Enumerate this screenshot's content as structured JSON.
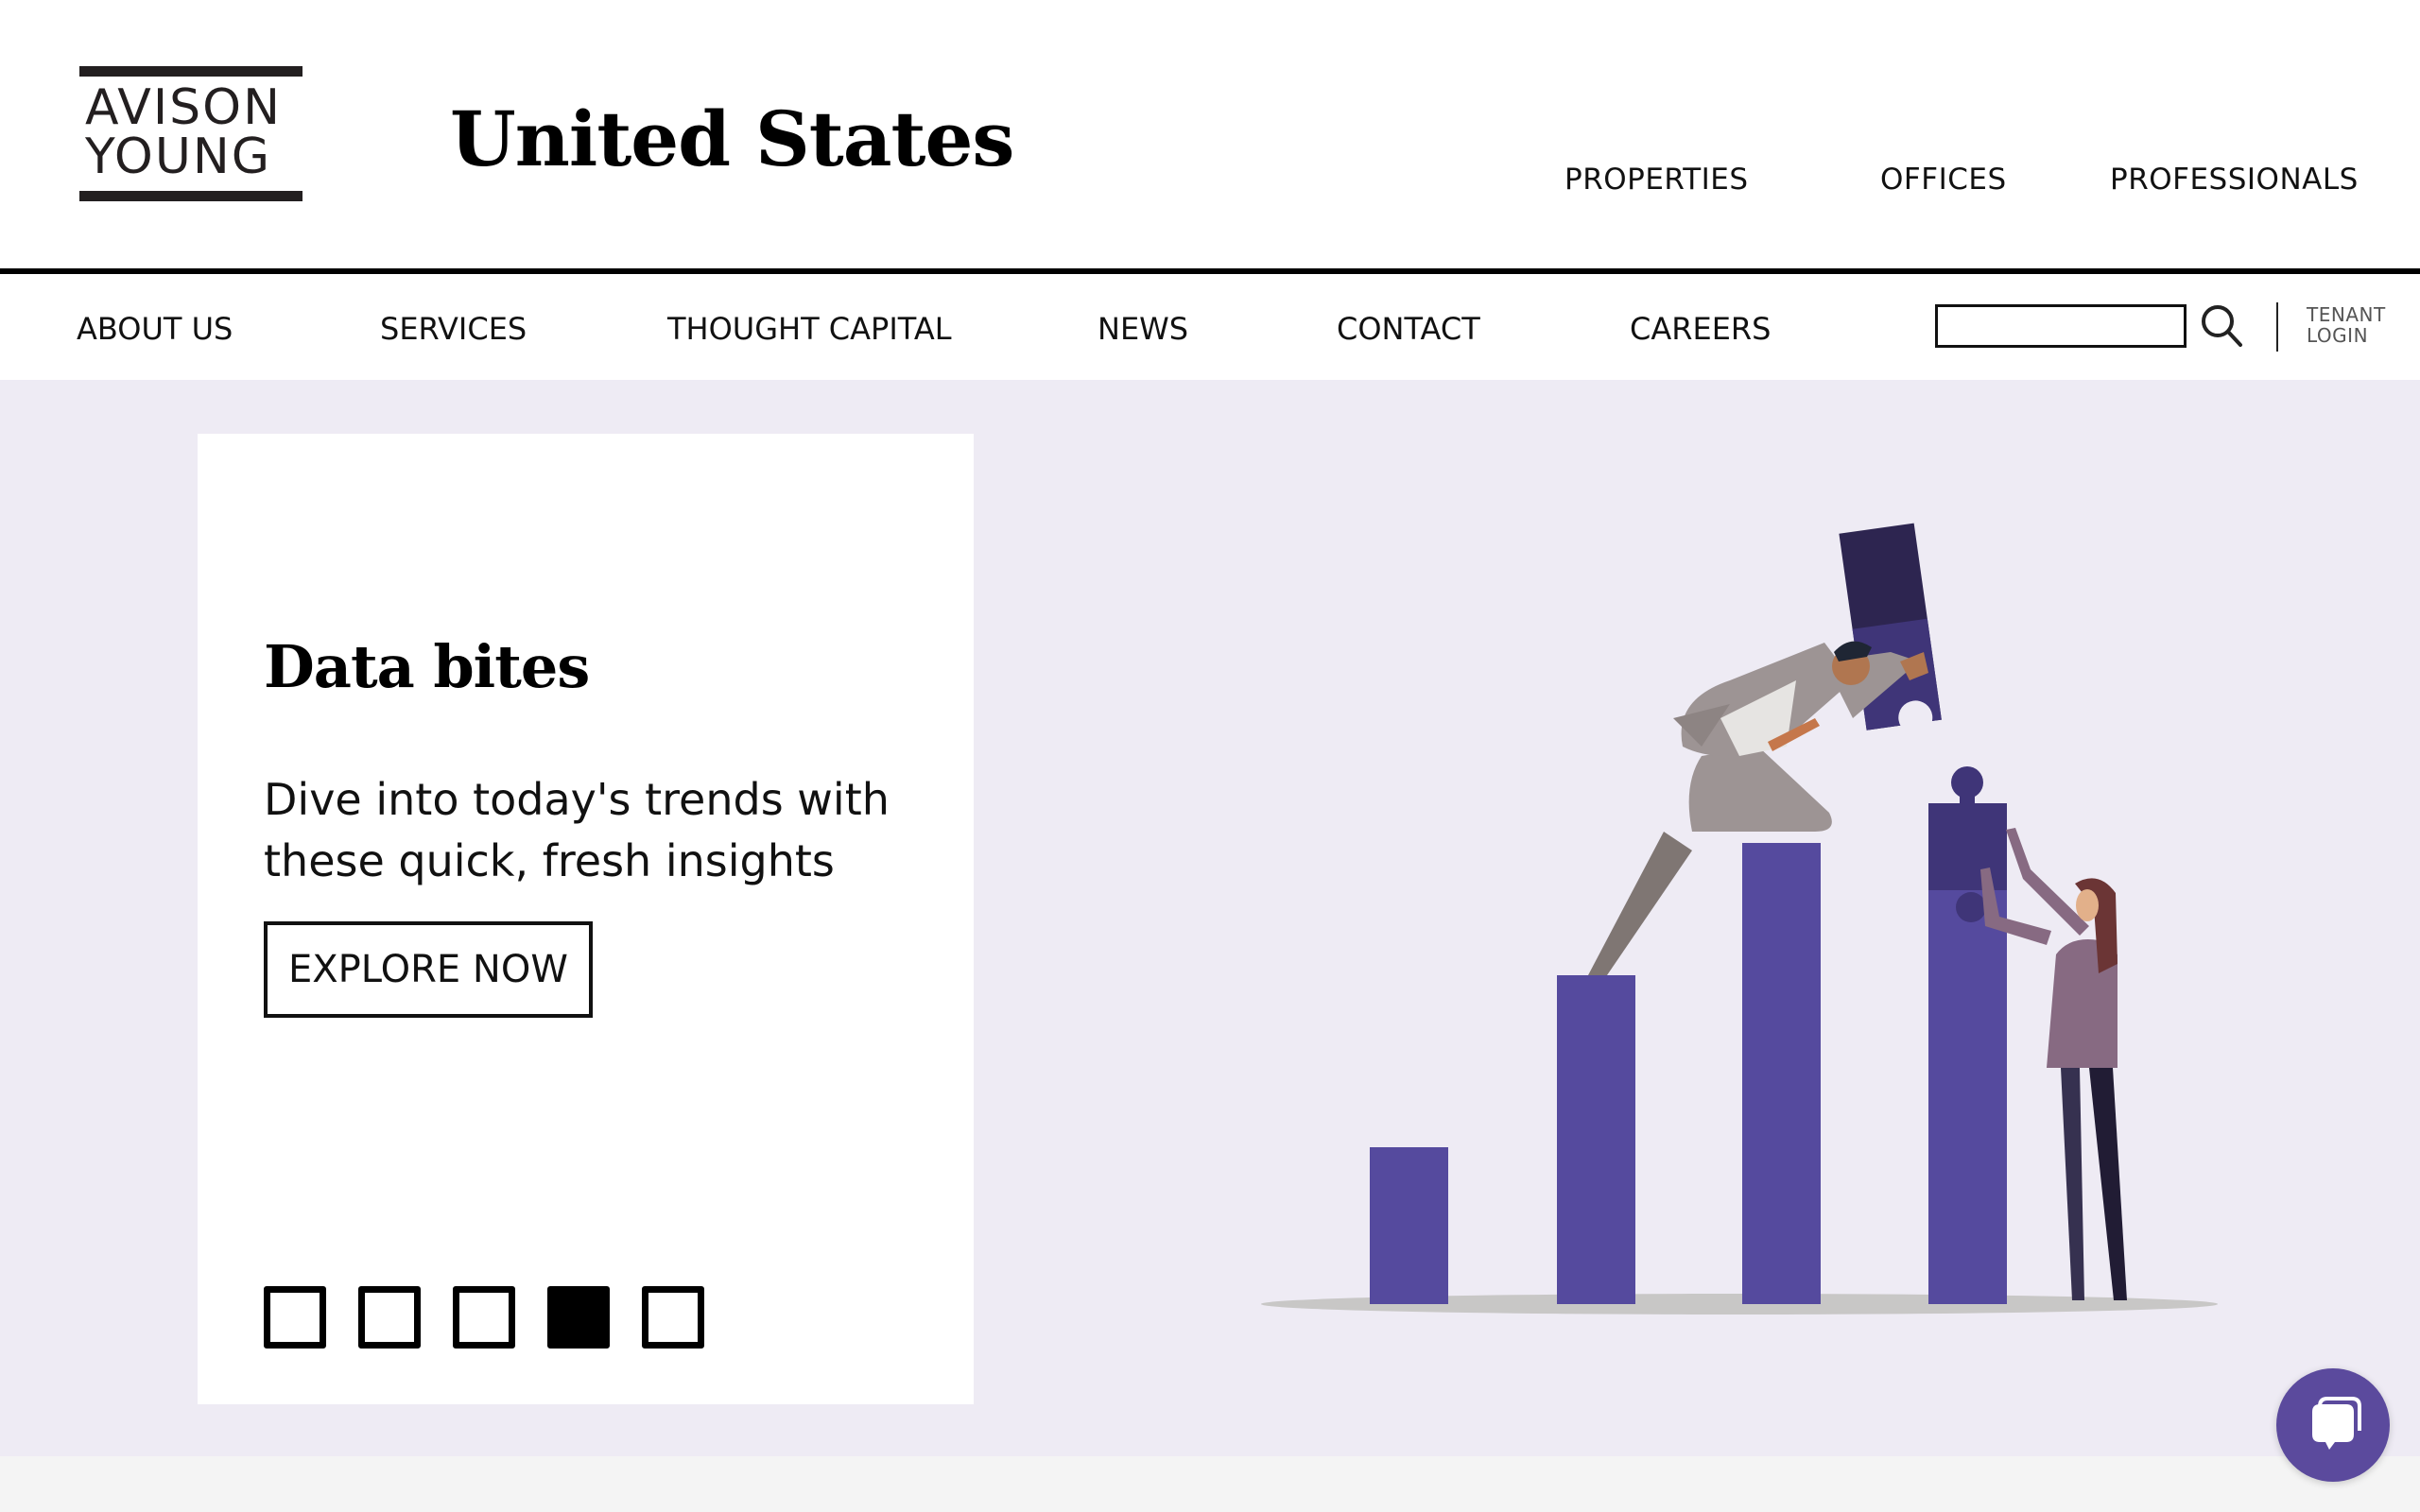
{
  "brand": {
    "logo_line1": "AVISON",
    "logo_line2": "YOUNG",
    "site_title": "United States"
  },
  "top_links": [
    {
      "label": "PROPERTIES"
    },
    {
      "label": "OFFICES"
    },
    {
      "label": "PROFESSIONALS"
    }
  ],
  "nav": {
    "items": [
      {
        "label": "ABOUT US"
      },
      {
        "label": "SERVICES"
      },
      {
        "label": "THOUGHT CAPITAL"
      },
      {
        "label": "NEWS"
      },
      {
        "label": "CONTACT"
      },
      {
        "label": "CAREERS"
      }
    ],
    "search": {
      "value": "",
      "placeholder": "",
      "icon": "search-icon"
    },
    "tenant_login_line1": "TENANT",
    "tenant_login_line2": "LOGIN"
  },
  "hero": {
    "title": "Data bites",
    "description": "Dive into today's trends with these quick, fresh insights",
    "cta_label": "EXPLORE NOW",
    "slides_total": 5,
    "active_slide": 4,
    "illustration": "two people assembling puzzle-piece bar chart"
  },
  "chat": {
    "icon": "chat-bubbles-icon"
  },
  "colors": {
    "hero_bg": "#eeebf4",
    "bar_purple": "#554a9e",
    "puzzle_dark": "#2d2550",
    "chat_purple": "#5b4a9d",
    "footer_bg": "#f4f4f4"
  }
}
